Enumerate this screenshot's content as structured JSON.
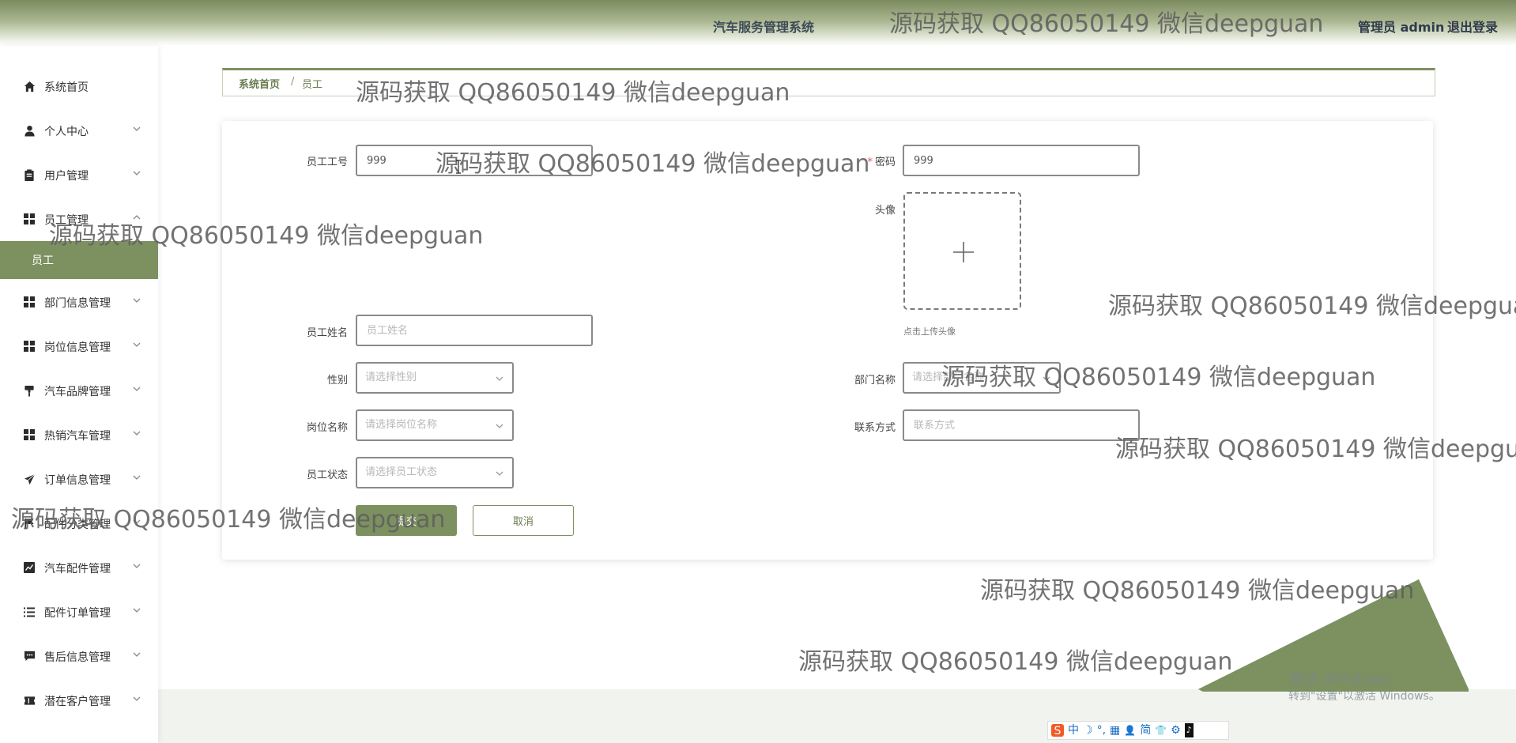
{
  "header": {
    "system_title": "汽车服务管理系统",
    "admin_label": "管理员 admin",
    "logout_label": "退出登录"
  },
  "sidebar": {
    "items": [
      {
        "label": "系统首页",
        "icon": "home-icon"
      },
      {
        "label": "个人中心",
        "icon": "user-icon"
      },
      {
        "label": "用户管理",
        "icon": "clipboard-icon"
      },
      {
        "label": "员工管理",
        "icon": "grid-icon"
      },
      {
        "label": "部门信息管理",
        "icon": "grid-icon"
      },
      {
        "label": "岗位信息管理",
        "icon": "grid-icon"
      },
      {
        "label": "汽车品牌管理",
        "icon": "brush-icon"
      },
      {
        "label": "热销汽车管理",
        "icon": "grid-icon"
      },
      {
        "label": "订单信息管理",
        "icon": "send-icon"
      },
      {
        "label": "配件分类管理",
        "icon": "flag-icon"
      },
      {
        "label": "汽车配件管理",
        "icon": "chart-icon"
      },
      {
        "label": "配件订单管理",
        "icon": "list-icon"
      },
      {
        "label": "售后信息管理",
        "icon": "message-icon"
      },
      {
        "label": "潜在客户管理",
        "icon": "ticket-icon"
      }
    ],
    "active_sub": "员工"
  },
  "breadcrumb": {
    "home": "系统首页",
    "separator": "/",
    "current": "员工"
  },
  "form": {
    "employee_id_label": "员工工号",
    "employee_id_value": "999",
    "password_label": "密码",
    "password_value": "999",
    "avatar_label": "头像",
    "avatar_hint": "点击上传头像",
    "name_label": "员工姓名",
    "name_placeholder": "员工姓名",
    "gender_label": "性别",
    "gender_placeholder": "请选择性别",
    "department_label": "部门名称",
    "department_placeholder": "请选择部门名称",
    "position_label": "岗位名称",
    "position_placeholder": "请选择岗位名称",
    "contact_label": "联系方式",
    "contact_placeholder": "联系方式",
    "status_label": "员工状态",
    "status_placeholder": "请选择员工状态",
    "submit_label": "提交",
    "cancel_label": "取消"
  },
  "watermark_text": "源码获取 QQ86050149 微信deepguan",
  "windows_activation": {
    "line1": "激活 Windows",
    "line2": "转到\"设置\"以激活 Windows。"
  },
  "ime_bar": {
    "logo": "S",
    "items": [
      "中",
      "☽",
      "°,",
      "▦",
      "👤",
      "简",
      "👕",
      "⚙",
      "♪"
    ]
  },
  "colors": {
    "accent": "#7d9160",
    "header_gradient_top": "#7a8b5e",
    "bottom_band": "#f1f3ee"
  }
}
